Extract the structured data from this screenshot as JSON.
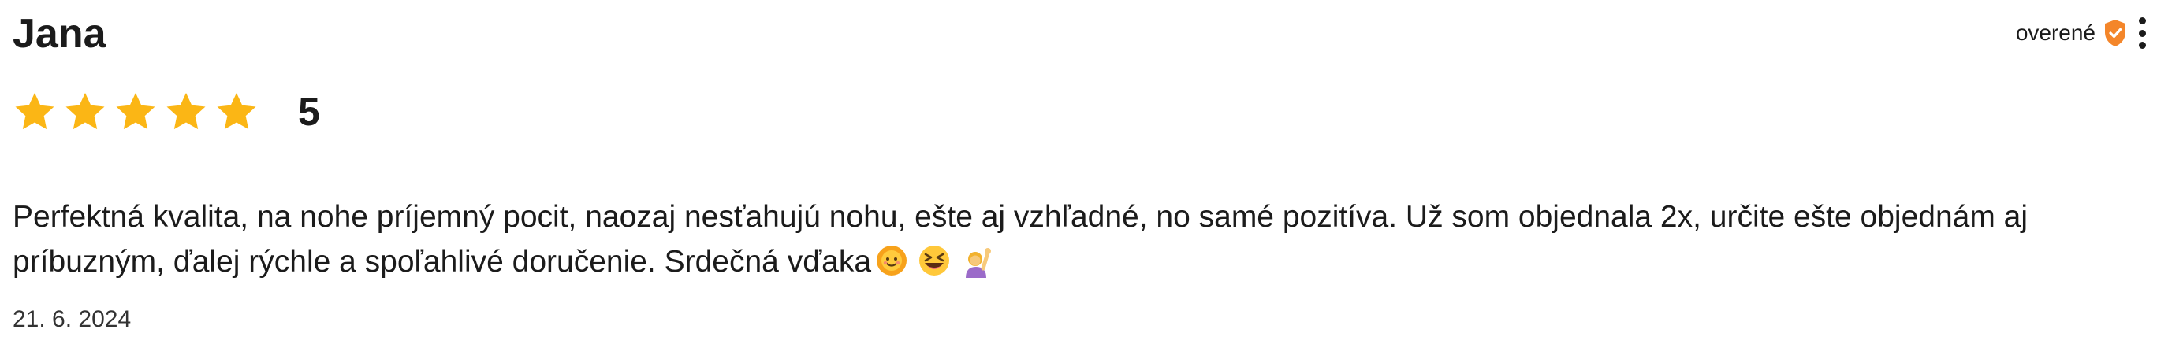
{
  "review": {
    "reviewer_name": "Jana",
    "verified_label": "overené",
    "rating": {
      "value": 5,
      "max": 5,
      "display": "5"
    },
    "text": "Perfektná kvalita, na nohe príjemný pocit, naozaj nesťahujú nohu, ešte aj vzhľadné, no samé pozitíva. Už som objednala 2x, určite ešte objednám aj príbuzným, ďalej rýchle a spoľahlivé doručenie. Srdečná vďaka",
    "emojis": [
      "smiling-sun-emoji",
      "grinning-squinting-emoji",
      "person-raising-hand-emoji"
    ],
    "date": "21. 6. 2024"
  },
  "icons": {
    "verified": "shield-check-icon",
    "more": "more-vertical-icon",
    "star": "star-icon"
  },
  "colors": {
    "star": "#FBB615",
    "shield": "#F4862A",
    "text": "#1B1B1B"
  }
}
